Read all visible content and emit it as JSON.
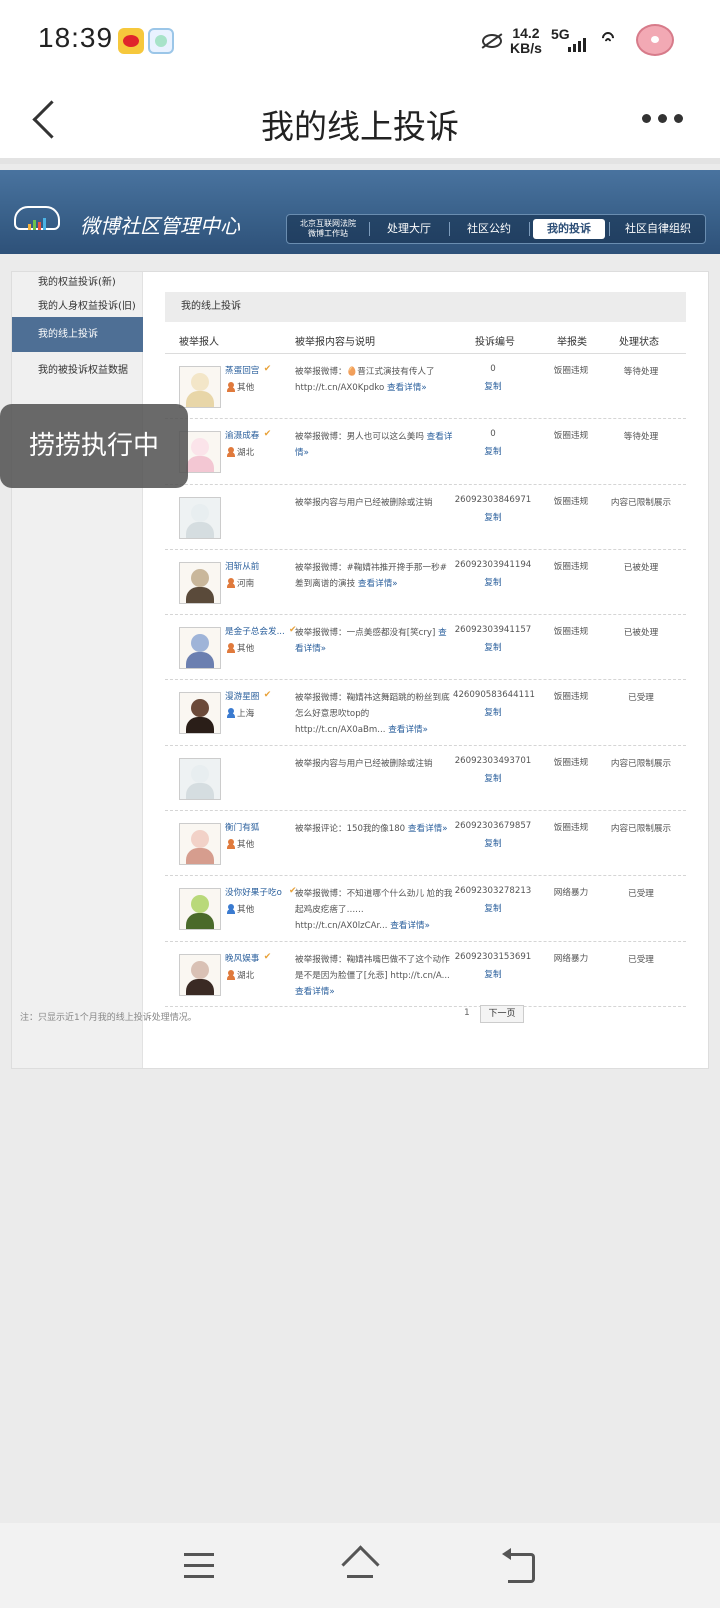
{
  "status_bar": {
    "time": "18:39",
    "speed_value": "14.2",
    "speed_unit": "KB/s",
    "network": "5G",
    "app_icons": [
      "weibo-icon",
      "app-icon"
    ]
  },
  "header": {
    "title": "我的线上投诉"
  },
  "banner": {
    "title": "微博社区管理中心",
    "nav": {
      "beijing_line1": "北京互联网法院",
      "beijing_line2": "微博工作站",
      "hall": "处理大厅",
      "convention": "社区公约",
      "my_complaints": "我的投诉",
      "autonomy": "社区自律组织"
    }
  },
  "sidebar": {
    "items": [
      {
        "label": "我的权益投诉(新)"
      },
      {
        "label": "我的人身权益投诉(旧)"
      },
      {
        "label": "我的线上投诉"
      },
      {
        "label": "我的被投诉权益数据"
      }
    ]
  },
  "content": {
    "heading": "我的线上投诉",
    "columns": {
      "reported_user": "被举报人",
      "content": "被举报内容与说明",
      "number": "投诉编号",
      "type": "举报类",
      "status": "处理状态"
    },
    "rows": [
      {
        "name": "蒸蛋回宫",
        "vip": true,
        "location": "其他",
        "gender": "f",
        "desc": "被举报微博：🥚晋江式演技有传人了 http://t.cn/AX0Kpdko",
        "more": "查看详情»",
        "id": "0",
        "copy": "复制",
        "type": "饭圈违规",
        "status": "等待处理"
      },
      {
        "name": "渝滠成春",
        "vip": true,
        "location": "湖北",
        "gender": "f",
        "desc": "被举报微博：男人也可以这么美吗",
        "more": "查看详情»",
        "id": "0",
        "copy": "复制",
        "type": "饭圈违规",
        "status": "等待处理"
      },
      {
        "name": "",
        "vip": false,
        "location": "",
        "gender": "",
        "desc": "被举报内容与用户已经被删除或注销",
        "more": "",
        "id": "26092303846971",
        "copy": "复制",
        "type": "饭圈违规",
        "status": "内容已限制展示"
      },
      {
        "name": "泪斩从前",
        "vip": false,
        "location": "河南",
        "gender": "f",
        "desc": "被举报微博：#鞠婧祎推开搀手那一秒#差到离谱的演技",
        "more": "查看详情»",
        "id": "26092303941194",
        "copy": "复制",
        "type": "饭圈违规",
        "status": "已被处理"
      },
      {
        "name": "是金子总会发...",
        "vip": true,
        "location": "其他",
        "gender": "f",
        "desc": "被举报微博：一点美感都没有[笑cry]",
        "more": "查看详情»",
        "id": "26092303941157",
        "copy": "复制",
        "type": "饭圈违规",
        "status": "已被处理"
      },
      {
        "name": "漫游星圈",
        "vip": true,
        "location": "上海",
        "gender": "m",
        "desc": "被举报微博：鞠婧祎这舞蹈跳的粉丝到底怎么好意思吹top的 http://t.cn/AX0aBm...",
        "more": "查看详情»",
        "id": "426090583644111",
        "copy": "复制",
        "type": "饭圈违规",
        "status": "已受理"
      },
      {
        "name": "",
        "vip": false,
        "location": "",
        "gender": "",
        "desc": "被举报内容与用户已经被删除或注销",
        "more": "",
        "id": "26092303493701",
        "copy": "复制",
        "type": "饭圈违规",
        "status": "内容已限制展示"
      },
      {
        "name": "衡门有狐",
        "vip": false,
        "location": "其他",
        "gender": "f",
        "desc": "被举报评论：150我的像180",
        "more": "查看详情»",
        "id": "26092303679857",
        "copy": "复制",
        "type": "饭圈违规",
        "status": "内容已限制展示"
      },
      {
        "name": "没你好果子吃o",
        "vip": true,
        "location": "其他",
        "gender": "m",
        "desc": "被举报微博：不知道哪个什么劲儿 尬的我起鸡皮疙瘩了…… http://t.cn/AX0lzCAr...",
        "more": "查看详情»",
        "id": "26092303278213",
        "copy": "复制",
        "type": "网络暴力",
        "status": "已受理"
      },
      {
        "name": "晚风娱事",
        "vip": true,
        "location": "湖北",
        "gender": "f",
        "desc": "被举报微博：鞠婧祎嘴巴做不了这个动作是不是因为脸僵了[允悲] http://t.cn/A...",
        "more": "查看详情»",
        "id": "26092303153691",
        "copy": "复制",
        "type": "网络暴力",
        "status": "已受理"
      }
    ],
    "footer_note": "注：只显示近1个月我的线上投诉处理情况。",
    "page_number": "1",
    "next_page": "下一页"
  },
  "toast": {
    "text": "捞捞执行中"
  },
  "bottom_nav": [
    "menu-icon",
    "home-icon",
    "return-icon"
  ]
}
